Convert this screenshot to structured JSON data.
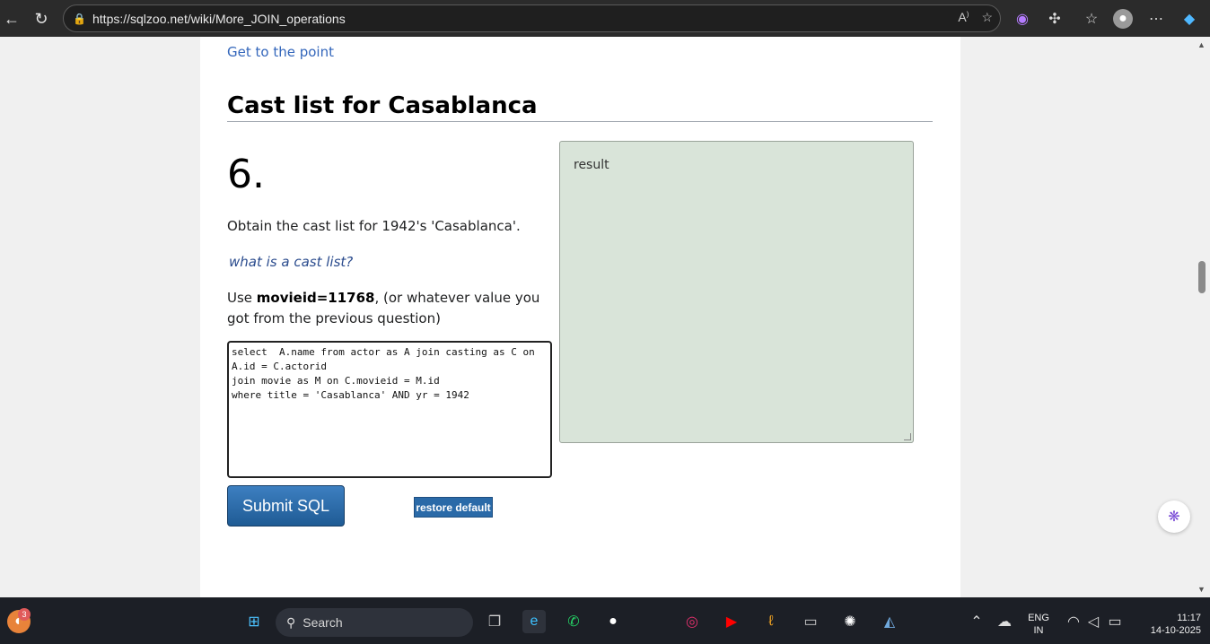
{
  "browser": {
    "url": "https://sqlzoo.net/wiki/More_JOIN_operations"
  },
  "page": {
    "top_link": "Get to the point",
    "section_title": "Cast list for Casablanca",
    "question_number": "6.",
    "task_text": "Obtain the cast list for 1942's 'Casablanca'.",
    "hint_link": "what is a cast list?",
    "use_prefix": "Use ",
    "use_bold": "movieid=11768",
    "use_suffix": ", (or whatever value you got from the previous question)",
    "sql_text": "select  A.name from actor as A join casting as C on A.id = C.actorid\njoin movie as M on C.movieid = M.id\nwhere title = 'Casablanca' AND yr = 1942",
    "submit_label": "Submit SQL",
    "restore_label": "restore default",
    "result_label": "result"
  },
  "taskbar": {
    "search_label": "Search",
    "notification_count": "3",
    "lang_line1": "ENG",
    "lang_line2": "IN",
    "time": "11:17",
    "date": "14-10-2025"
  },
  "colors": {
    "link": "#3366bb",
    "submit_bg": "#2a6aa8",
    "result_bg": "#d9e4d9",
    "taskbar_bg": "#1c1f26",
    "browser_bg": "#2b2b2b"
  }
}
